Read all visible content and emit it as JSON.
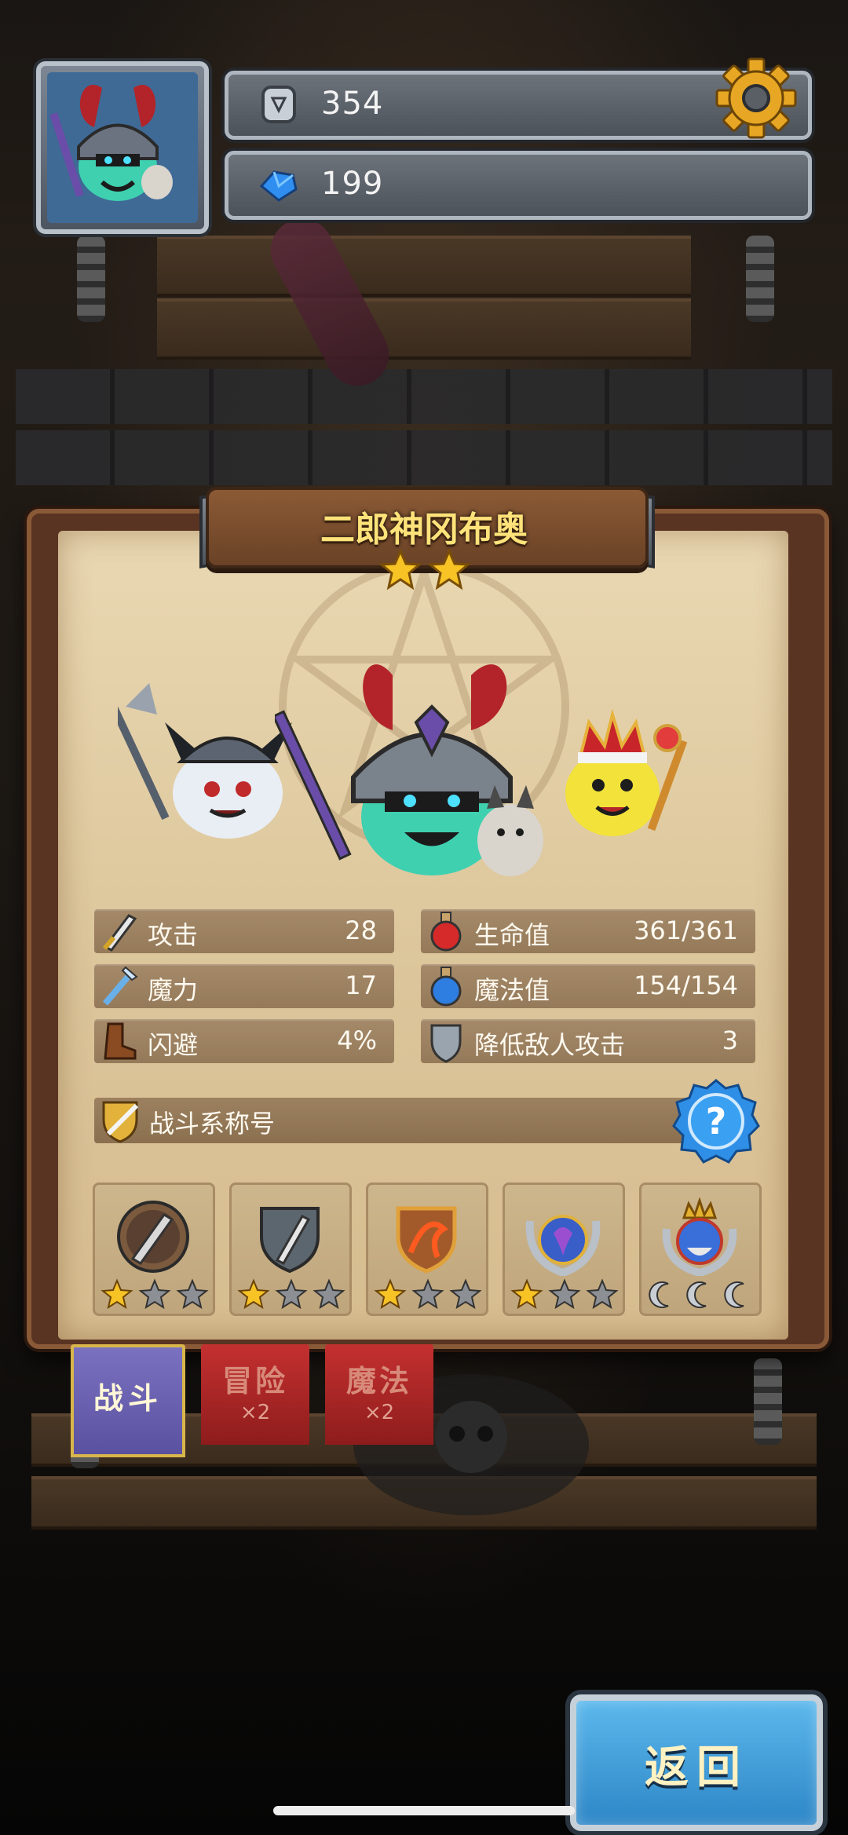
{
  "hud": {
    "stone_count": "354",
    "gem_count": "199"
  },
  "hero": {
    "name": "二郎神冈布奥",
    "star_rating": 2,
    "star_max": 2
  },
  "stats": {
    "left": [
      {
        "label": "攻击",
        "value": "28",
        "icon": "sword-icon"
      },
      {
        "label": "魔力",
        "value": "17",
        "icon": "magic-wand-icon"
      },
      {
        "label": "闪避",
        "value": "4%",
        "icon": "boot-icon"
      }
    ],
    "right": [
      {
        "label": "生命值",
        "value": "361/361",
        "icon": "red-potion-icon"
      },
      {
        "label": "魔法值",
        "value": "154/154",
        "icon": "blue-potion-icon"
      },
      {
        "label": "降低敌人攻击",
        "value": "3",
        "icon": "shield-icon"
      }
    ]
  },
  "title_section": {
    "label": "战斗系称号",
    "help_symbol": "?"
  },
  "badges": [
    {
      "name": "spear-badge",
      "stars": 1,
      "max": 3
    },
    {
      "name": "dagger-shield-badge",
      "stars": 1,
      "max": 3
    },
    {
      "name": "dragon-shield-badge",
      "stars": 1,
      "max": 3
    },
    {
      "name": "laurel-demon-badge",
      "stars": 1,
      "max": 3
    },
    {
      "name": "crowned-king-badge",
      "stars": 0,
      "max": 3
    }
  ],
  "tabs": [
    {
      "label": "战斗",
      "multiplier": ""
    },
    {
      "label": "冒险",
      "multiplier": "×2"
    },
    {
      "label": "魔法",
      "multiplier": "×2"
    }
  ],
  "back_button": "返回",
  "colors": {
    "title_gold": "#ffe37a",
    "star_gold": "#f7c325",
    "back_button_blue": "#3d9ad8",
    "tab_active": "#6a63b0",
    "tab_inactive": "#b02a2a"
  }
}
